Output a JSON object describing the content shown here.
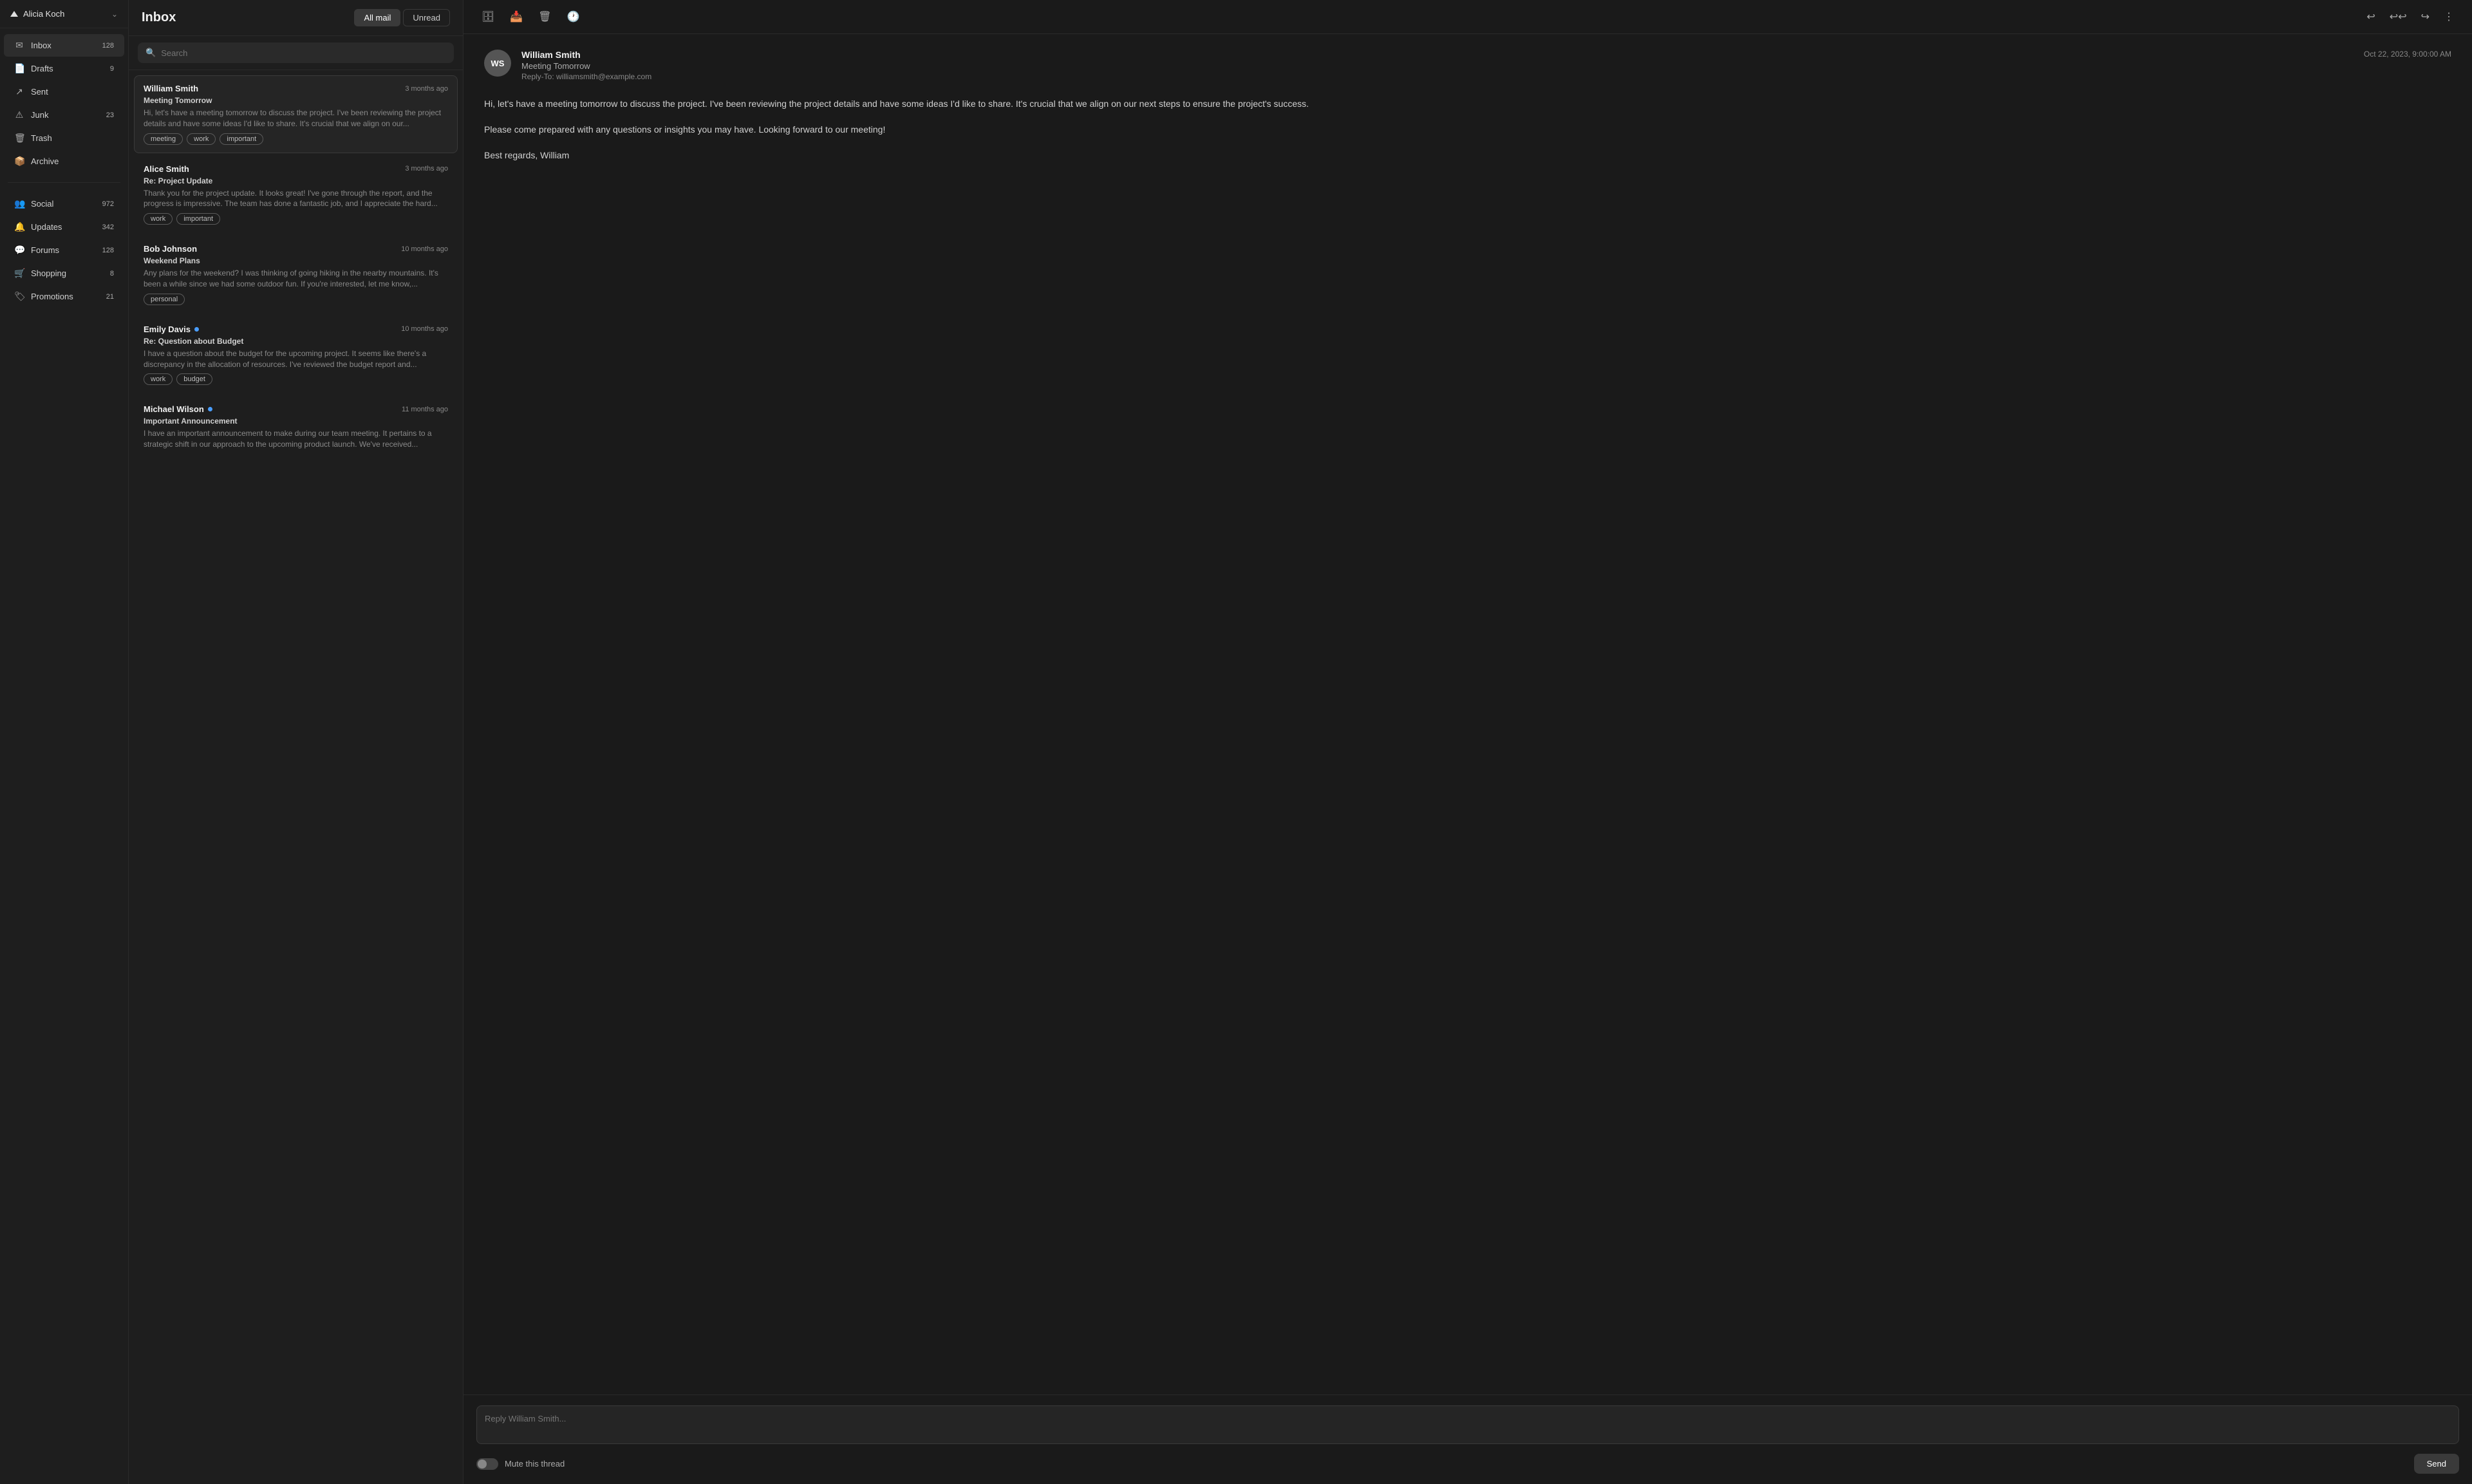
{
  "account": {
    "name": "Alicia Koch",
    "chevron": "⌄"
  },
  "sidebar": {
    "items": [
      {
        "id": "inbox",
        "icon": "✉",
        "label": "Inbox",
        "badge": "128"
      },
      {
        "id": "drafts",
        "icon": "📄",
        "label": "Drafts",
        "badge": "9"
      },
      {
        "id": "sent",
        "icon": "↗",
        "label": "Sent",
        "badge": ""
      },
      {
        "id": "junk",
        "icon": "⚠",
        "label": "Junk",
        "badge": "23"
      },
      {
        "id": "trash",
        "icon": "🗑",
        "label": "Trash",
        "badge": ""
      },
      {
        "id": "archive",
        "icon": "📦",
        "label": "Archive",
        "badge": ""
      }
    ],
    "category_items": [
      {
        "id": "social",
        "icon": "👥",
        "label": "Social",
        "badge": "972"
      },
      {
        "id": "updates",
        "icon": "🔔",
        "label": "Updates",
        "badge": "342"
      },
      {
        "id": "forums",
        "icon": "💬",
        "label": "Forums",
        "badge": "128"
      },
      {
        "id": "shopping",
        "icon": "🛒",
        "label": "Shopping",
        "badge": "8"
      },
      {
        "id": "promotions",
        "icon": "🏷",
        "label": "Promotions",
        "badge": "21"
      }
    ]
  },
  "inbox": {
    "title": "Inbox",
    "filters": [
      {
        "id": "all",
        "label": "All mail",
        "active": true
      },
      {
        "id": "unread",
        "label": "Unread",
        "active": false
      }
    ],
    "search": {
      "placeholder": "Search"
    }
  },
  "mails": [
    {
      "id": 1,
      "sender": "William Smith",
      "unread": false,
      "time": "3 months ago",
      "subject": "Meeting Tomorrow",
      "preview": "Hi, let's have a meeting tomorrow to discuss the project. I've been reviewing the project details and have some ideas I'd like to share. It's crucial that we align on our...",
      "tags": [
        "meeting",
        "work",
        "important"
      ],
      "selected": true
    },
    {
      "id": 2,
      "sender": "Alice Smith",
      "unread": false,
      "time": "3 months ago",
      "subject": "Re: Project Update",
      "preview": "Thank you for the project update. It looks great! I've gone through the report, and the progress is impressive. The team has done a fantastic job, and I appreciate the hard...",
      "tags": [
        "work",
        "important"
      ],
      "selected": false
    },
    {
      "id": 3,
      "sender": "Bob Johnson",
      "unread": false,
      "time": "10 months ago",
      "subject": "Weekend Plans",
      "preview": "Any plans for the weekend? I was thinking of going hiking in the nearby mountains. It's been a while since we had some outdoor fun. If you're interested, let me know,...",
      "tags": [
        "personal"
      ],
      "selected": false
    },
    {
      "id": 4,
      "sender": "Emily Davis",
      "unread": true,
      "time": "10 months ago",
      "subject": "Re: Question about Budget",
      "preview": "I have a question about the budget for the upcoming project. It seems like there's a discrepancy in the allocation of resources. I've reviewed the budget report and...",
      "tags": [
        "work",
        "budget"
      ],
      "selected": false
    },
    {
      "id": 5,
      "sender": "Michael Wilson",
      "unread": true,
      "time": "11 months ago",
      "subject": "Important Announcement",
      "preview": "I have an important announcement to make during our team meeting. It pertains to a strategic shift in our approach to the upcoming product launch. We've received...",
      "tags": [],
      "selected": false
    }
  ],
  "reading": {
    "avatar_initials": "WS",
    "from_name": "William Smith",
    "subject": "Meeting Tomorrow",
    "reply_to": "Reply-To: williamsmith@example.com",
    "date": "Oct 22, 2023, 9:00:00 AM",
    "body": [
      "Hi, let's have a meeting tomorrow to discuss the project. I've been reviewing the project details and have some ideas I'd like to share. It's crucial that we align on our next steps to ensure the project's success.",
      "Please come prepared with any questions or insights you may have. Looking forward to our meeting!",
      "Best regards, William"
    ],
    "reply_placeholder": "Reply William Smith...",
    "mute_label": "Mute this thread",
    "send_label": "Send"
  },
  "toolbar": {
    "icons": [
      "🗄",
      "📥",
      "🗑",
      "🕐",
      "↩",
      "↩↩",
      "↪",
      "⋮"
    ]
  }
}
